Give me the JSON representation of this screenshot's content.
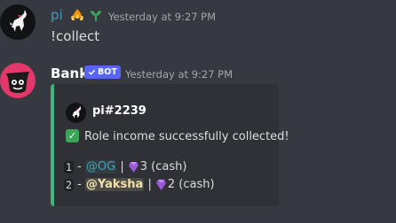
{
  "messages": [
    {
      "author": "pi",
      "author_color": "#4a97b8",
      "badges": [
        "fire-hands-icon",
        "sprout-icon"
      ],
      "timestamp": "Yesterday at 9:27 PM",
      "content": "!collect"
    },
    {
      "author": "Bank",
      "author_color": "#ffffff",
      "tag": "BOT",
      "tag_color": "#5865f2",
      "timestamp": "Yesterday at 9:27 PM",
      "embed": {
        "border_color": "#43b581",
        "author": "pi#2239",
        "description": "Role income successfully collected!",
        "rows": [
          {
            "index": "1",
            "dash": "-",
            "mention": "@OG",
            "separator": "|",
            "amount": "3 (cash)"
          },
          {
            "index": "2",
            "dash": "-",
            "mention": "@Yaksha",
            "separator": "|",
            "amount": "2 (cash)"
          }
        ]
      }
    }
  ]
}
